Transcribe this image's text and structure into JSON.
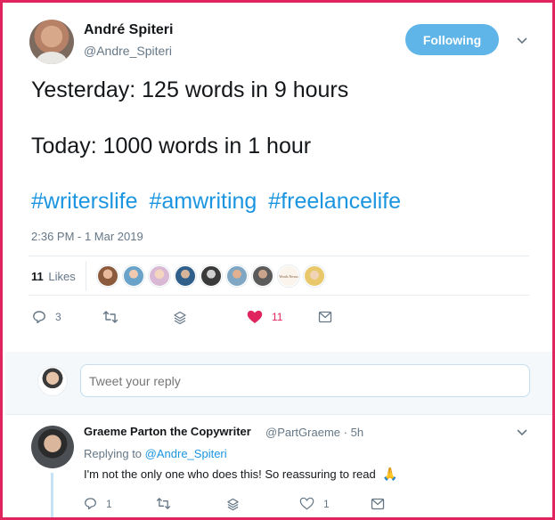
{
  "tweet": {
    "author_name": "André Spiteri",
    "author_handle": "@Andre_Spiteri",
    "follow_label": "Following",
    "lines": [
      "Yesterday: 125 words in 9 hours",
      "Today: 1000 words in 1 hour"
    ],
    "hashtags": [
      "#writerslife",
      "#amwriting",
      "#freelancelife"
    ],
    "timestamp": "2:36 PM - 1 Mar 2019",
    "likes_count": "11",
    "likes_label": "Likes",
    "likers_visible_text": "Words Nexus",
    "actions": {
      "reply_count": "3",
      "like_count": "11"
    }
  },
  "reply_box": {
    "placeholder": "Tweet your reply"
  },
  "reply": {
    "author_name": "Graeme Parton the Copywriter",
    "author_handle": "@PartGraeme",
    "separator": "·",
    "time": "5h",
    "replying_prefix": "Replying to",
    "replying_to": "@Andre_Spiteri",
    "text": "I'm not the only one who does this! So reassuring to read",
    "emoji": "🙏",
    "actions": {
      "reply_count": "1",
      "like_count": "1"
    }
  },
  "colors": {
    "frame_border": "#e0245e",
    "follow_button": "#5fb4e8",
    "link": "#1b95e0",
    "like_active": "#e0245e",
    "secondary_text": "#657786"
  },
  "icons": {
    "reply": "speech-bubble-icon",
    "retweet": "retweet-icon",
    "stack": "layers-icon",
    "like": "heart-icon",
    "dm": "envelope-icon",
    "menu": "chevron-down-icon"
  }
}
